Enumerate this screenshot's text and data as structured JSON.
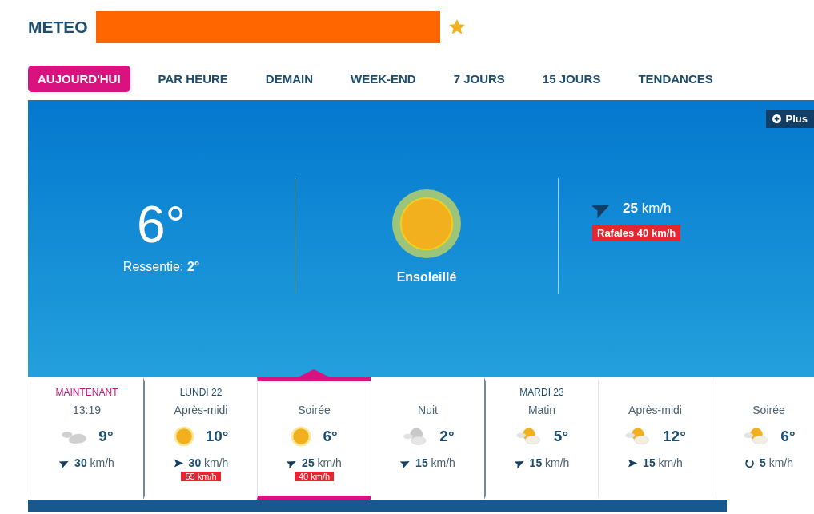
{
  "header": {
    "title": "METEO",
    "favorite": true
  },
  "tabs": [
    {
      "label": "AUJOURD'HUI",
      "selected": true
    },
    {
      "label": "PAR HEURE",
      "selected": false
    },
    {
      "label": "DEMAIN",
      "selected": false
    },
    {
      "label": "WEEK-END",
      "selected": false
    },
    {
      "label": "7 JOURS",
      "selected": false
    },
    {
      "label": "15 JOURS",
      "selected": false
    },
    {
      "label": "TENDANCES",
      "selected": false
    }
  ],
  "current": {
    "more_button": "Plus",
    "temperature": "6°",
    "feels_like_label": "Ressentie:",
    "feels_like": "2°",
    "condition": "Ensoleillé",
    "kind": "sun",
    "wind": {
      "kind": "ne",
      "speed": "25",
      "unit": "km/h"
    },
    "gusts": "Rafales 40 km/h"
  },
  "forecast": [
    {
      "day": "MAINTENANT",
      "now": true,
      "period": "13:19",
      "kind": "cloud",
      "temperature": "9°",
      "wind": {
        "kind": "ne",
        "speed": "30",
        "unit": "km/h"
      },
      "selected": false
    },
    {
      "day": "LUNDI 22",
      "now": false,
      "period": "Après-midi",
      "kind": "sun",
      "temperature": "10°",
      "wind": {
        "kind": "e",
        "speed": "30",
        "unit": "km/h"
      },
      "gusts": "55 km/h",
      "selected": false
    },
    {
      "period": "Soirée",
      "kind": "sun",
      "temperature": "6°",
      "wind": {
        "kind": "ne",
        "speed": "25",
        "unit": "km/h"
      },
      "gusts": "40 km/h",
      "selected": true
    },
    {
      "period": "Nuit",
      "kind": "moon-cloud",
      "temperature": "2°",
      "wind": {
        "kind": "ne",
        "speed": "15",
        "unit": "km/h"
      },
      "selected": false
    },
    {
      "day": "MARDI 23",
      "now": false,
      "period": "Matin",
      "kind": "sun-cloud",
      "temperature": "5°",
      "wind": {
        "kind": "ne",
        "speed": "15",
        "unit": "km/h"
      },
      "selected": false
    },
    {
      "period": "Après-midi",
      "kind": "sun-cloud",
      "temperature": "12°",
      "wind": {
        "kind": "e",
        "speed": "15",
        "unit": "km/h"
      },
      "selected": false
    },
    {
      "period": "Soirée",
      "kind": "sun-cloud",
      "temperature": "6°",
      "wind": {
        "kind": "variable",
        "speed": "5",
        "unit": "km/h"
      },
      "selected": false
    }
  ]
}
